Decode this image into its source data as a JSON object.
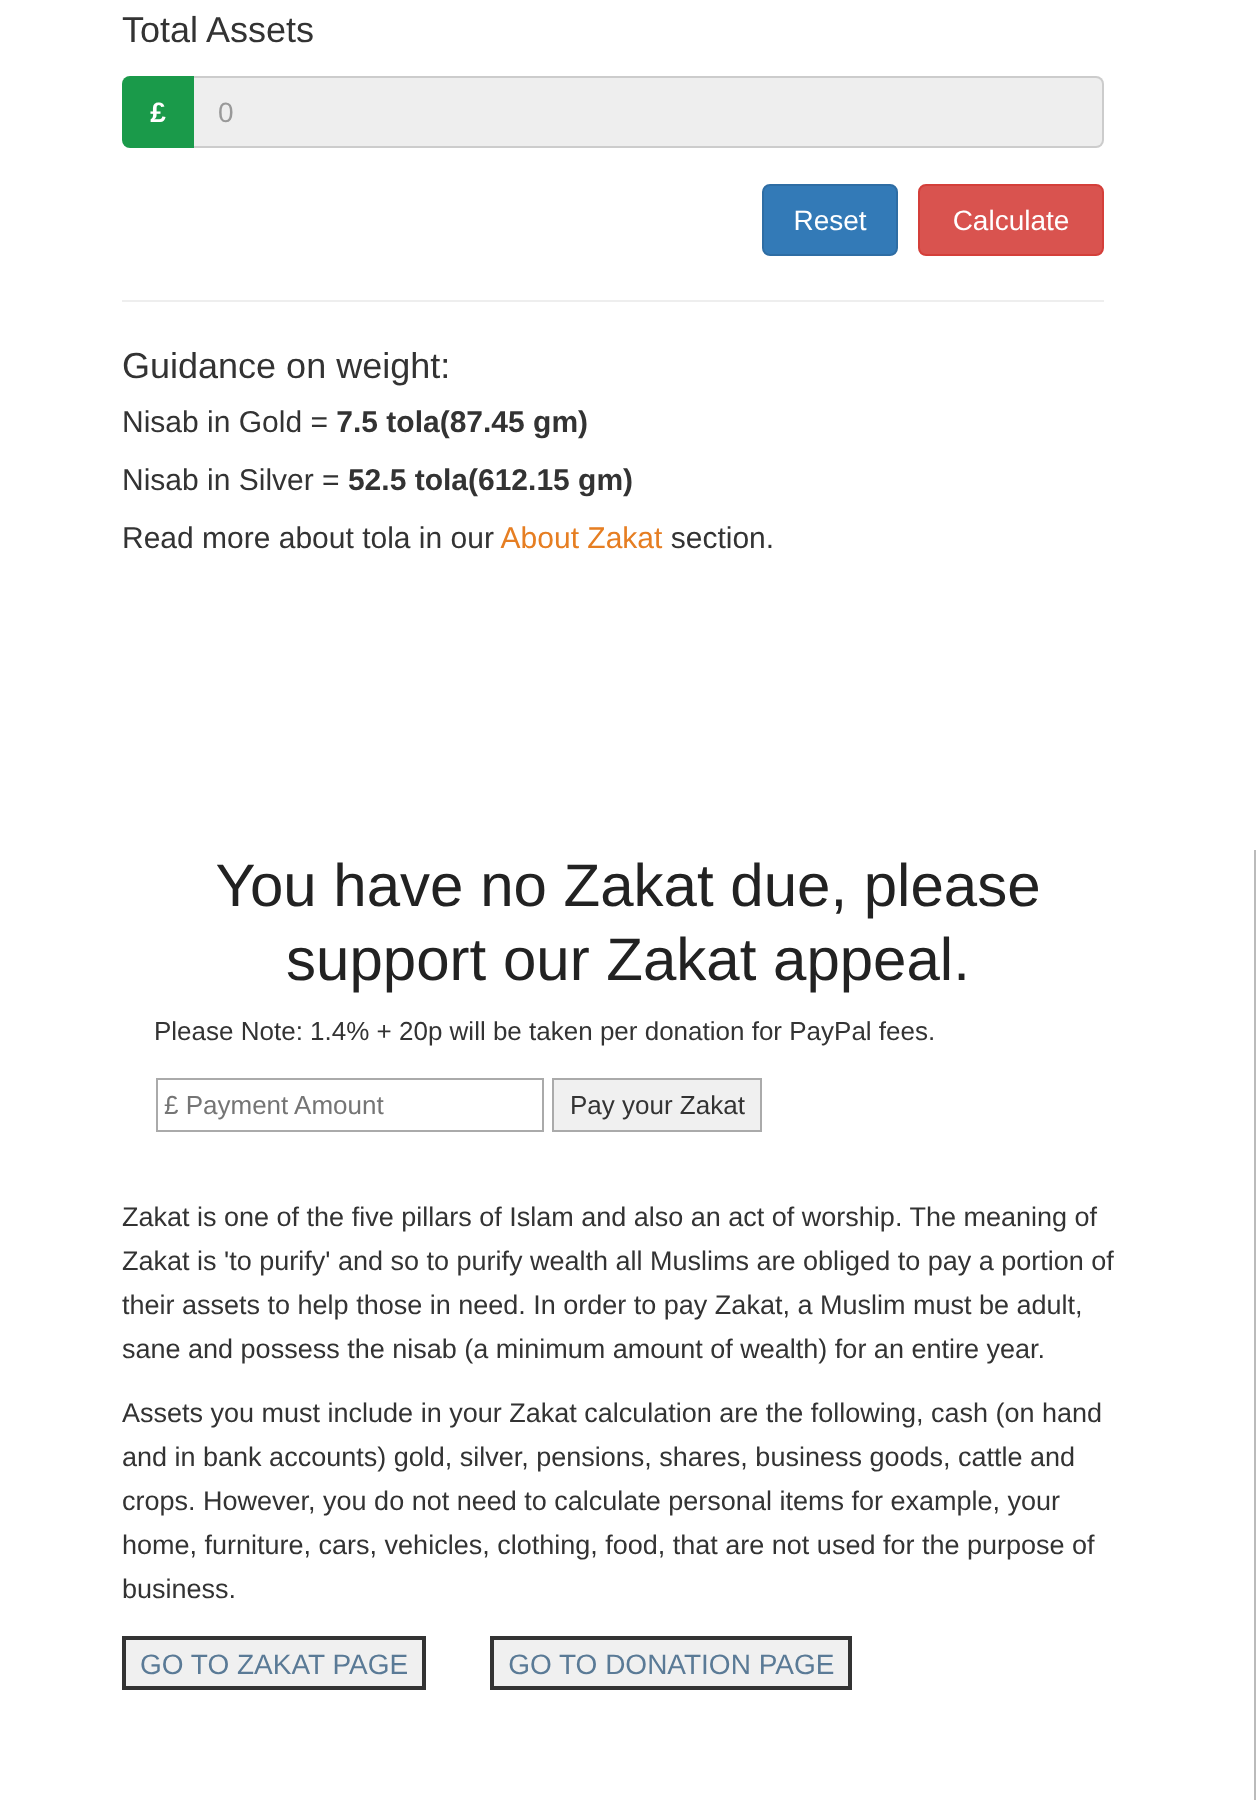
{
  "total_assets": {
    "label": "Total Assets",
    "currency": "£",
    "value": "0"
  },
  "buttons": [
    {
      "label": "Reset",
      "kind": "primary"
    },
    {
      "label": "Calculate",
      "kind": "danger"
    }
  ],
  "guidance": {
    "heading": "Guidance on weight:",
    "lines": [
      "Nisab in Gold = **7.5 tola(87.45 gm)**",
      "Nisab in Silver = **52.5 tola(612.15 gm)**"
    ],
    "more": {
      "before": "Read more about tola in our ",
      "link": "About Zakat",
      "after": " section."
    }
  },
  "appeal": {
    "heading": "You have no Zakat due, please support our Zakat appeal.",
    "note": "Please Note: 1.4% + 20p will be taken per donation for PayPal fees.",
    "amount_placeholder": "£ Payment Amount",
    "pay_button": "Pay your Zakat"
  },
  "paragraphs": [
    "Zakat is one of the five pillars of Islam and also an act of worship. The meaning of Zakat is 'to purify' and so to purify wealth all Muslims are obliged to pay a portion of their assets to help those in need. In order to pay Zakat, a Muslim must be adult, sane and possess the nisab (a minimum amount of wealth) for an entire year.",
    "Assets you must include in your Zakat calculation are the following, cash (on hand and in bank accounts) gold, silver, pensions, shares, business goods, cattle and crops. However, you do not need to calculate personal items for example, your home, furniture, cars, vehicles, clothing, food, that are not used for the purpose of business."
  ],
  "links": [
    "GO TO ZAKAT PAGE",
    "GO TO DONATION PAGE"
  ]
}
